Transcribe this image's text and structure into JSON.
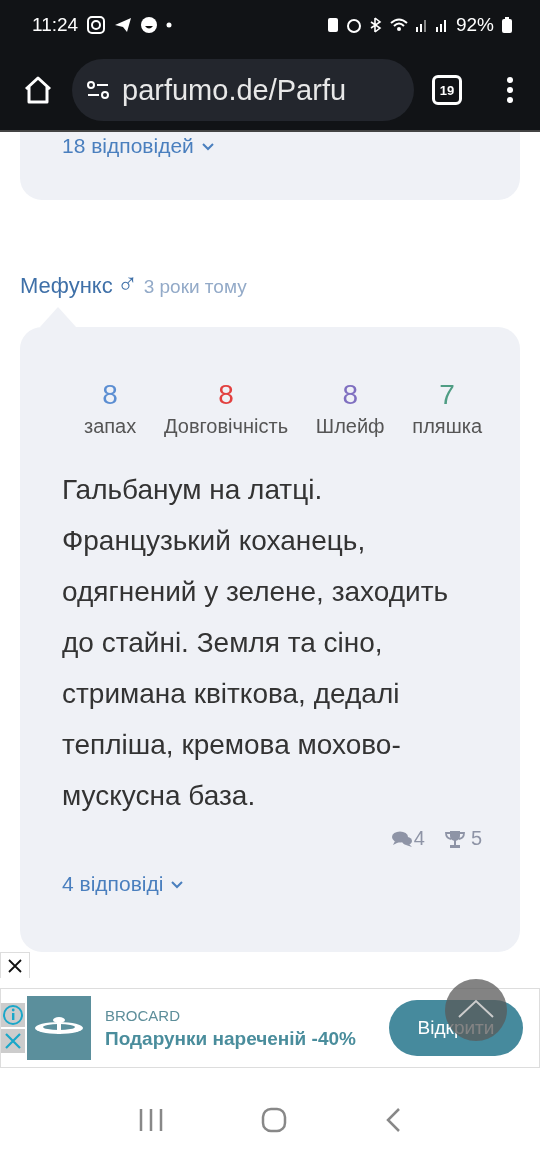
{
  "status_bar": {
    "time": "11:24",
    "battery": "92%"
  },
  "browser": {
    "url": "parfumo.de/Parfu",
    "tab_count": "19"
  },
  "previous_card": {
    "replies_link": "18 відповідей"
  },
  "review": {
    "author": "Мефункс",
    "gender_symbol": "♂",
    "time": "3 роки тому",
    "ratings": [
      {
        "value": "8",
        "label": "запах",
        "color": "#5b8ed2"
      },
      {
        "value": "8",
        "label": "Довговічність",
        "color": "#e2403f"
      },
      {
        "value": "8",
        "label": "Шлейф",
        "color": "#7f6fc0"
      },
      {
        "value": "7",
        "label": "пляшка",
        "color": "#4f9d84"
      }
    ],
    "text": "Гальбанум на латці. Французький коханець, одягнений у зелене, заходить до стайні. Земля та сіно, стримана квіткова, дедалі тепліша, кремова мохово-мускусна база.",
    "comments": "4",
    "awards": "5",
    "replies_link": "4 відповіді"
  },
  "ad": {
    "brand": "BROCARD",
    "headline": "Подарунки нареченій -40%",
    "button": "Відкрити"
  }
}
